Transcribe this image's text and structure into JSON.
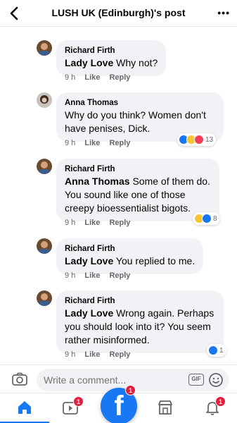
{
  "header": {
    "title": "LUSH UK (Edinburgh)'s post",
    "more_label": "•••"
  },
  "comments": [
    {
      "author": "Richard Firth",
      "tag": "Lady Love",
      "text": " Why not?",
      "time": "9 h",
      "like": "Like",
      "reply": "Reply"
    },
    {
      "author": "Anna Thomas",
      "tag": "",
      "text": "Why do you think? Women don't have penises, Dick.",
      "time": "9 h",
      "like": "Like",
      "reply": "Reply",
      "reaction_count": "13"
    },
    {
      "author": "Richard Firth",
      "tag": "Anna Thomas",
      "text": " Some of them do. You sound like one of those creepy bioessentialist bigots.",
      "time": "9 h",
      "like": "Like",
      "reply": "Reply",
      "reaction_count": "8"
    },
    {
      "author": "Richard Firth",
      "tag": "Lady Love",
      "text": " You replied to me.",
      "time": "9 h",
      "like": "Like",
      "reply": "Reply"
    },
    {
      "author": "Richard Firth",
      "tag": "Lady Love",
      "text": " Wrong again. Perhaps you should look into it? You seem rather misinformed.",
      "time": "9 h",
      "like": "Like",
      "reply": "Reply",
      "reaction_count": "1"
    }
  ],
  "composer": {
    "placeholder": "Write a comment...",
    "gif_label": "GIF"
  },
  "tabbar": {
    "watch_badge": "1",
    "home_badge": "1",
    "notifications_badge": "1",
    "logo_letter": "f"
  },
  "colors": {
    "accent": "#1877f2",
    "bubble": "#f0f2f5",
    "badge": "#e41e3f",
    "muted": "#65676b"
  }
}
